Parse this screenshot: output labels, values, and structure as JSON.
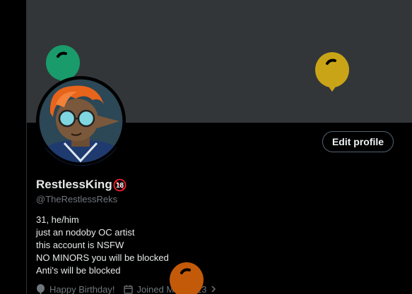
{
  "profile": {
    "display_name": "RestlessKing",
    "age_badge": "18",
    "handle": "@TheRestlessReks",
    "bio_lines": [
      "31, he/him",
      "just an nodoby OC artist",
      "this account is NSFW",
      "NO MINORS you will be blocked",
      "Anti's will be blocked"
    ],
    "birthday": "Happy Birthday!",
    "joined": "Joined May 2023"
  },
  "actions": {
    "edit_profile_label": "Edit profile"
  },
  "icons": {
    "birthday": "balloon-icon",
    "joined": "calendar-icon",
    "joined_chevron": "chevron-right-icon"
  },
  "colors": {
    "background": "#000000",
    "banner": "#333639",
    "text_primary": "#e7e9ea",
    "text_secondary": "#71767b",
    "button_border": "#536471",
    "balloon_green": "#1a9b6b",
    "balloon_yellow": "#c9a417",
    "balloon_orange": "#c25a0a",
    "age_badge": "#f4212e"
  }
}
